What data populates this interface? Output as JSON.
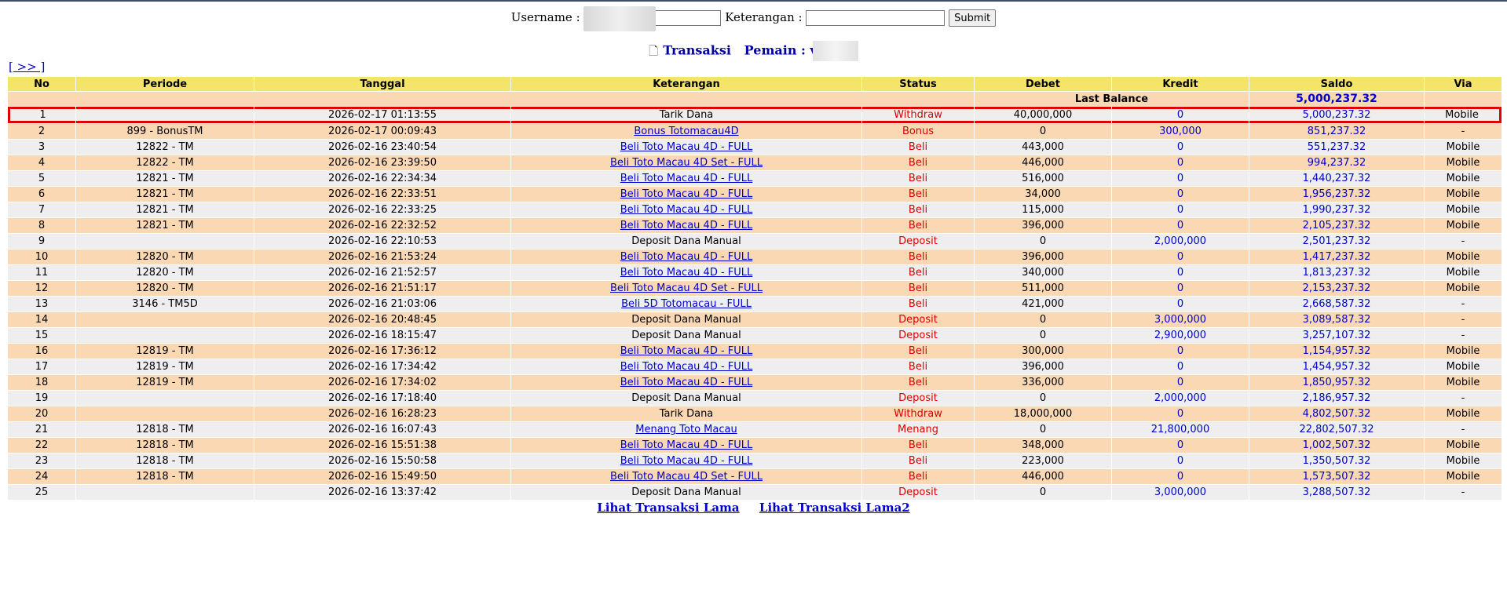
{
  "search": {
    "username_label": "Username :",
    "keterangan_label": "Keterangan :",
    "submit_label": "Submit"
  },
  "title": {
    "transaksi": "Transaksi",
    "pemain_label": "Pemain : v"
  },
  "nav": {
    "next": "[ >> ]"
  },
  "table": {
    "headers": [
      "No",
      "Periode",
      "Tanggal",
      "Keterangan",
      "Status",
      "Debet",
      "Kredit",
      "Saldo",
      "Via"
    ],
    "last_balance_label": "Last Balance",
    "last_balance_value": "5,000,237.32",
    "rows": [
      {
        "no": "1",
        "periode": "",
        "tanggal": "2026-02-17 01:13:55",
        "ket": "Tarik Dana",
        "status": "Withdraw",
        "debet": "40,000,000",
        "kredit": "0",
        "saldo": "5,000,237.32",
        "via": "Mobile"
      },
      {
        "no": "2",
        "periode": "899 - BonusTM",
        "tanggal": "2026-02-17 00:09:43",
        "ket": "Bonus Totomacau4D",
        "status": "Bonus",
        "debet": "0",
        "kredit": "300,000",
        "saldo": "851,237.32",
        "via": "-"
      },
      {
        "no": "3",
        "periode": "12822 - TM",
        "tanggal": "2026-02-16 23:40:54",
        "ket": "Beli Toto Macau 4D - FULL",
        "status": "Beli",
        "debet": "443,000",
        "kredit": "0",
        "saldo": "551,237.32",
        "via": "Mobile"
      },
      {
        "no": "4",
        "periode": "12822 - TM",
        "tanggal": "2026-02-16 23:39:50",
        "ket": "Beli Toto Macau 4D Set - FULL",
        "status": "Beli",
        "debet": "446,000",
        "kredit": "0",
        "saldo": "994,237.32",
        "via": "Mobile"
      },
      {
        "no": "5",
        "periode": "12821 - TM",
        "tanggal": "2026-02-16 22:34:34",
        "ket": "Beli Toto Macau 4D - FULL",
        "status": "Beli",
        "debet": "516,000",
        "kredit": "0",
        "saldo": "1,440,237.32",
        "via": "Mobile"
      },
      {
        "no": "6",
        "periode": "12821 - TM",
        "tanggal": "2026-02-16 22:33:51",
        "ket": "Beli Toto Macau 4D - FULL",
        "status": "Beli",
        "debet": "34,000",
        "kredit": "0",
        "saldo": "1,956,237.32",
        "via": "Mobile"
      },
      {
        "no": "7",
        "periode": "12821 - TM",
        "tanggal": "2026-02-16 22:33:25",
        "ket": "Beli Toto Macau 4D - FULL",
        "status": "Beli",
        "debet": "115,000",
        "kredit": "0",
        "saldo": "1,990,237.32",
        "via": "Mobile"
      },
      {
        "no": "8",
        "periode": "12821 - TM",
        "tanggal": "2026-02-16 22:32:52",
        "ket": "Beli Toto Macau 4D - FULL",
        "status": "Beli",
        "debet": "396,000",
        "kredit": "0",
        "saldo": "2,105,237.32",
        "via": "Mobile"
      },
      {
        "no": "9",
        "periode": "",
        "tanggal": "2026-02-16 22:10:53",
        "ket": "Deposit Dana Manual",
        "status": "Deposit",
        "debet": "0",
        "kredit": "2,000,000",
        "saldo": "2,501,237.32",
        "via": "-"
      },
      {
        "no": "10",
        "periode": "12820 - TM",
        "tanggal": "2026-02-16 21:53:24",
        "ket": "Beli Toto Macau 4D - FULL",
        "status": "Beli",
        "debet": "396,000",
        "kredit": "0",
        "saldo": "1,417,237.32",
        "via": "Mobile"
      },
      {
        "no": "11",
        "periode": "12820 - TM",
        "tanggal": "2026-02-16 21:52:57",
        "ket": "Beli Toto Macau 4D - FULL",
        "status": "Beli",
        "debet": "340,000",
        "kredit": "0",
        "saldo": "1,813,237.32",
        "via": "Mobile"
      },
      {
        "no": "12",
        "periode": "12820 - TM",
        "tanggal": "2026-02-16 21:51:17",
        "ket": "Beli Toto Macau 4D Set - FULL",
        "status": "Beli",
        "debet": "511,000",
        "kredit": "0",
        "saldo": "2,153,237.32",
        "via": "Mobile"
      },
      {
        "no": "13",
        "periode": "3146 - TM5D",
        "tanggal": "2026-02-16 21:03:06",
        "ket": "Beli 5D Totomacau - FULL",
        "status": "Beli",
        "debet": "421,000",
        "kredit": "0",
        "saldo": "2,668,587.32",
        "via": "-"
      },
      {
        "no": "14",
        "periode": "",
        "tanggal": "2026-02-16 20:48:45",
        "ket": "Deposit Dana Manual",
        "status": "Deposit",
        "debet": "0",
        "kredit": "3,000,000",
        "saldo": "3,089,587.32",
        "via": "-"
      },
      {
        "no": "15",
        "periode": "",
        "tanggal": "2026-02-16 18:15:47",
        "ket": "Deposit Dana Manual",
        "status": "Deposit",
        "debet": "0",
        "kredit": "2,900,000",
        "saldo": "3,257,107.32",
        "via": "-"
      },
      {
        "no": "16",
        "periode": "12819 - TM",
        "tanggal": "2026-02-16 17:36:12",
        "ket": "Beli Toto Macau 4D - FULL",
        "status": "Beli",
        "debet": "300,000",
        "kredit": "0",
        "saldo": "1,154,957.32",
        "via": "Mobile"
      },
      {
        "no": "17",
        "periode": "12819 - TM",
        "tanggal": "2026-02-16 17:34:42",
        "ket": "Beli Toto Macau 4D - FULL",
        "status": "Beli",
        "debet": "396,000",
        "kredit": "0",
        "saldo": "1,454,957.32",
        "via": "Mobile"
      },
      {
        "no": "18",
        "periode": "12819 - TM",
        "tanggal": "2026-02-16 17:34:02",
        "ket": "Beli Toto Macau 4D - FULL",
        "status": "Beli",
        "debet": "336,000",
        "kredit": "0",
        "saldo": "1,850,957.32",
        "via": "Mobile"
      },
      {
        "no": "19",
        "periode": "",
        "tanggal": "2026-02-16 17:18:40",
        "ket": "Deposit Dana Manual",
        "status": "Deposit",
        "debet": "0",
        "kredit": "2,000,000",
        "saldo": "2,186,957.32",
        "via": "-"
      },
      {
        "no": "20",
        "periode": "",
        "tanggal": "2026-02-16 16:28:23",
        "ket": "Tarik Dana",
        "status": "Withdraw",
        "debet": "18,000,000",
        "kredit": "0",
        "saldo": "4,802,507.32",
        "via": "Mobile"
      },
      {
        "no": "21",
        "periode": "12818 - TM",
        "tanggal": "2026-02-16 16:07:43",
        "ket": "Menang Toto Macau",
        "status": "Menang",
        "debet": "0",
        "kredit": "21,800,000",
        "saldo": "22,802,507.32",
        "via": "-"
      },
      {
        "no": "22",
        "periode": "12818 - TM",
        "tanggal": "2026-02-16 15:51:38",
        "ket": "Beli Toto Macau 4D - FULL",
        "status": "Beli",
        "debet": "348,000",
        "kredit": "0",
        "saldo": "1,002,507.32",
        "via": "Mobile"
      },
      {
        "no": "23",
        "periode": "12818 - TM",
        "tanggal": "2026-02-16 15:50:58",
        "ket": "Beli Toto Macau 4D - FULL",
        "status": "Beli",
        "debet": "223,000",
        "kredit": "0",
        "saldo": "1,350,507.32",
        "via": "Mobile"
      },
      {
        "no": "24",
        "periode": "12818 - TM",
        "tanggal": "2026-02-16 15:49:50",
        "ket": "Beli Toto Macau 4D Set - FULL",
        "status": "Beli",
        "debet": "446,000",
        "kredit": "0",
        "saldo": "1,573,507.32",
        "via": "Mobile"
      },
      {
        "no": "25",
        "periode": "",
        "tanggal": "2026-02-16 13:37:42",
        "ket": "Deposit Dana Manual",
        "status": "Deposit",
        "debet": "0",
        "kredit": "3,000,000",
        "saldo": "3,288,507.32",
        "via": "-"
      }
    ]
  },
  "footer": {
    "lihat_lama": "Lihat Transaksi Lama",
    "lihat_lama2": "Lihat Transaksi Lama2"
  },
  "colors": {
    "header_bg": "#f5e46a",
    "row_odd": "#eeeeee",
    "row_even": "#fad8b4",
    "status_red": "#dd0000",
    "link_blue": "#0000cc",
    "highlight": "#e00000"
  }
}
